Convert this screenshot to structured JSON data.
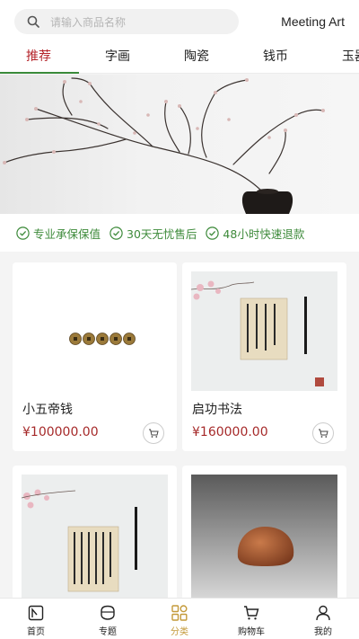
{
  "header": {
    "search_placeholder": "请输入商品名称",
    "brand": "Meeting Art"
  },
  "tabs": [
    {
      "label": "推荐",
      "active": true
    },
    {
      "label": "字画",
      "active": false
    },
    {
      "label": "陶瓷",
      "active": false
    },
    {
      "label": "钱币",
      "active": false
    },
    {
      "label": "玉器",
      "active": false
    }
  ],
  "guarantees": [
    "专业承保保值",
    "30天无忧售后",
    "48小时快速退款"
  ],
  "products": [
    {
      "name": "小五帝钱",
      "price": "¥100000.00"
    },
    {
      "name": "启功书法",
      "price": "¥160000.00"
    },
    {
      "name": "",
      "price": ""
    },
    {
      "name": "",
      "price": ""
    }
  ],
  "bottom_nav": [
    {
      "label": "首页",
      "icon": "home-icon"
    },
    {
      "label": "专题",
      "icon": "topic-icon"
    },
    {
      "label": "分类",
      "icon": "category-icon",
      "active": true
    },
    {
      "label": "购物车",
      "icon": "cart-icon"
    },
    {
      "label": "我的",
      "icon": "user-icon"
    }
  ],
  "colors": {
    "accent_red": "#b5262c",
    "green": "#3d8a3a",
    "price_red": "#a62a2a",
    "nav_active": "#c49a3a"
  }
}
